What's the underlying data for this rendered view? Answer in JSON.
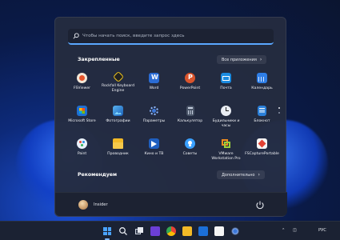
{
  "search": {
    "placeholder": "Чтобы начать поиск, введите запрос здесь"
  },
  "pinned": {
    "title": "Закрепленные",
    "all_apps_label": "Все приложения"
  },
  "apps": [
    {
      "name": "FSViewer",
      "icon": "fsviewer-icon"
    },
    {
      "name": "Rockfall Keyboard Engine",
      "icon": "rockfall-icon"
    },
    {
      "name": "Word",
      "icon": "word-icon"
    },
    {
      "name": "PowerPoint",
      "icon": "powerpoint-icon"
    },
    {
      "name": "Почта",
      "icon": "mail-icon"
    },
    {
      "name": "Календарь",
      "icon": "calendar-icon"
    },
    {
      "name": "Microsoft Store",
      "icon": "store-icon"
    },
    {
      "name": "Фотографии",
      "icon": "photos-icon"
    },
    {
      "name": "Параметры",
      "icon": "settings-icon"
    },
    {
      "name": "Калькулятор",
      "icon": "calculator-icon"
    },
    {
      "name": "Будильники и часы",
      "icon": "alarms-icon"
    },
    {
      "name": "Блокнот",
      "icon": "notepad-icon"
    },
    {
      "name": "Paint",
      "icon": "paint-icon"
    },
    {
      "name": "Проводник",
      "icon": "explorer-icon"
    },
    {
      "name": "Кино и ТВ",
      "icon": "movies-icon"
    },
    {
      "name": "Советы",
      "icon": "tips-icon"
    },
    {
      "name": "VMware Workstation Pro",
      "icon": "vmware-icon"
    },
    {
      "name": "FSCapturePortable",
      "icon": "fscapture-icon"
    }
  ],
  "recommended": {
    "title": "Рекомендуем",
    "more_label": "Дополнительно"
  },
  "user": {
    "name": "Insider"
  },
  "tray": {
    "language": "РУС"
  }
}
